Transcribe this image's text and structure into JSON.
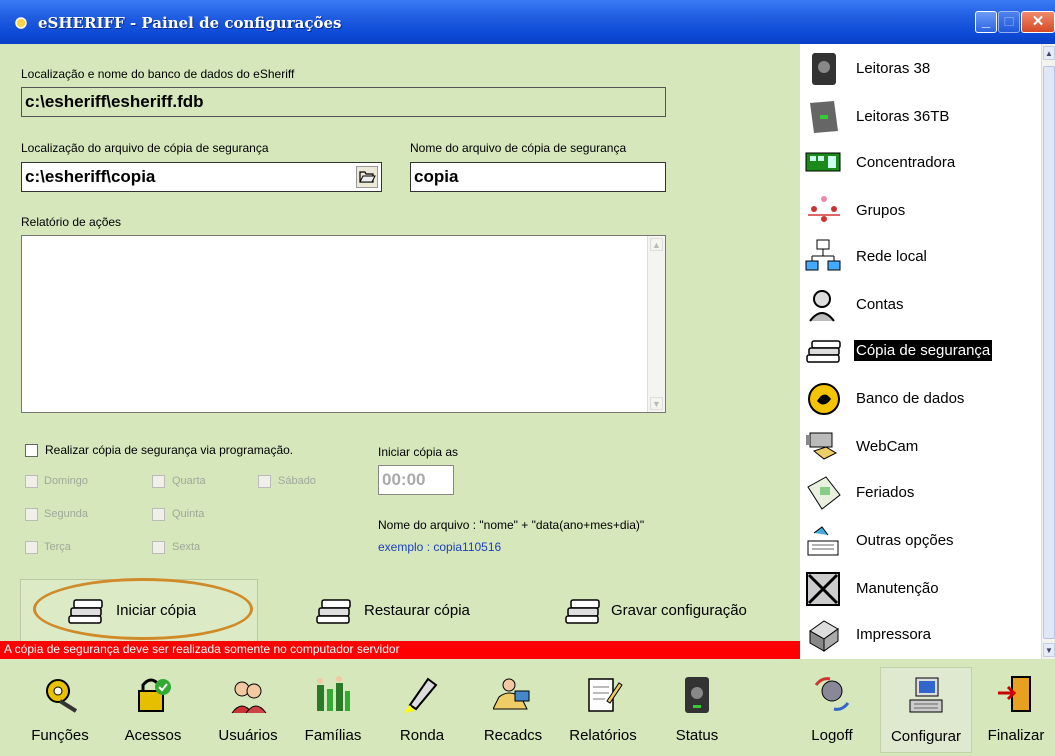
{
  "window": {
    "title": "eSHERIFF - Painel de configurações"
  },
  "db": {
    "label": "Localização e nome do banco de dados do eSheriff",
    "value": "c:\\esheriff\\esheriff.fdb"
  },
  "backup": {
    "location_label": "Localização do arquivo de cópia de segurança",
    "location_value": "c:\\esheriff\\copia",
    "name_label": "Nome do arquivo de cópia de segurança",
    "name_value": "copia",
    "report_label": "Relatório de ações"
  },
  "schedule": {
    "checkbox_label": "Realizar cópia de segurança via programação.",
    "days": [
      "Domingo",
      "Quarta",
      "Sábado",
      "Segunda",
      "Quinta",
      "Terça",
      "Sexta"
    ],
    "start_label": "Iniciar cópia as",
    "start_value": "00:00",
    "filename_hint": "Nome do arquivo : \"nome\" + \"data(ano+mes+dia)\"",
    "example": "exemplo : copia110516"
  },
  "actions": {
    "start_label": "Iniciar cópia",
    "restore_label": "Restaurar cópia",
    "save_label": "Gravar configuração"
  },
  "warning": "A cópia de segurança deve ser realizada somente no computador servidor",
  "sidebar": {
    "items": [
      {
        "label": "Leitoras 38",
        "icon": "reader-icon"
      },
      {
        "label": "Leitoras 36TB",
        "icon": "reader-36tb-icon"
      },
      {
        "label": "Concentradora",
        "icon": "concentrator-icon"
      },
      {
        "label": "Grupos",
        "icon": "groups-icon"
      },
      {
        "label": "Rede local",
        "icon": "network-icon"
      },
      {
        "label": "Contas",
        "icon": "accounts-icon"
      },
      {
        "label": "Cópia de segurança",
        "icon": "backup-icon",
        "selected": true
      },
      {
        "label": "Banco de dados",
        "icon": "database-icon"
      },
      {
        "label": "WebCam",
        "icon": "webcam-icon"
      },
      {
        "label": "Feriados",
        "icon": "holidays-icon"
      },
      {
        "label": "Outras opções",
        "icon": "options-icon"
      },
      {
        "label": "Manutenção",
        "icon": "maintenance-icon"
      },
      {
        "label": "Impressora",
        "icon": "printer-icon"
      }
    ]
  },
  "toolbar": {
    "items": [
      {
        "label": "Funções",
        "icon": "functions-icon"
      },
      {
        "label": "Acessos",
        "icon": "access-icon"
      },
      {
        "label": "Usuários",
        "icon": "users-icon"
      },
      {
        "label": "Famílias",
        "icon": "families-icon"
      },
      {
        "label": "Ronda",
        "icon": "flashlight-icon"
      },
      {
        "label": "Recadcs",
        "icon": "messages-icon"
      },
      {
        "label": "Relatórios",
        "icon": "reports-icon"
      },
      {
        "label": "Status",
        "icon": "status-icon"
      },
      {
        "label": "Logoff",
        "icon": "logoff-icon"
      },
      {
        "label": "Configurar",
        "icon": "configure-icon",
        "active": true
      },
      {
        "label": "Finalizar",
        "icon": "exit-icon"
      }
    ]
  }
}
